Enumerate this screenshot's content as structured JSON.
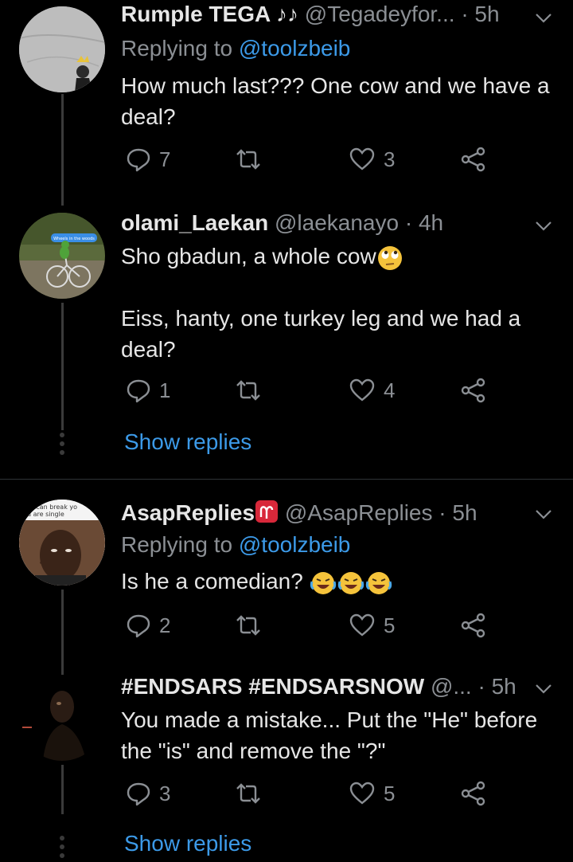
{
  "tweets": [
    {
      "name": "Rumple TEGA ♪♪",
      "handle": "@Tegadeyfor...",
      "time": "· 5h",
      "replying_prefix": "Replying to",
      "replying_to": "@toolzbeib",
      "text": "How much last??? One cow and we have a deal?",
      "replies": "7",
      "retweets": "",
      "likes": "3"
    },
    {
      "name": "olami_Laekan",
      "handle": "@laekanayo",
      "time": "· 4h",
      "text_line1": "Sho gbadun, a whole cow",
      "text_line2": "Eiss, hanty, one turkey leg and we had a deal?",
      "avatar_caption": "Wheels in the woods",
      "replies": "1",
      "retweets": "",
      "likes": "4",
      "show_replies": "Show replies"
    },
    {
      "name": "AsapReplies",
      "handle": "@AsapReplies",
      "time": "· 5h",
      "replying_prefix": "Replying to",
      "replying_to": "@toolzbeib",
      "text": "Is he a comedian?",
      "avatar_caption_1": "y can break yo",
      "avatar_caption_2": "u are single",
      "replies": "2",
      "retweets": "",
      "likes": "5"
    },
    {
      "name": "#ENDSARS #ENDSARSNOW",
      "handle": "@...",
      "time": "· 5h",
      "text": "You made a mistake... Put the \"He\" before the \"is\" and remove the \"?\"",
      "replies": "3",
      "retweets": "",
      "likes": "5",
      "show_replies": "Show replies"
    }
  ],
  "colors": {
    "accent": "#3c9ae8",
    "muted": "#8b8f94",
    "background": "#000000"
  }
}
